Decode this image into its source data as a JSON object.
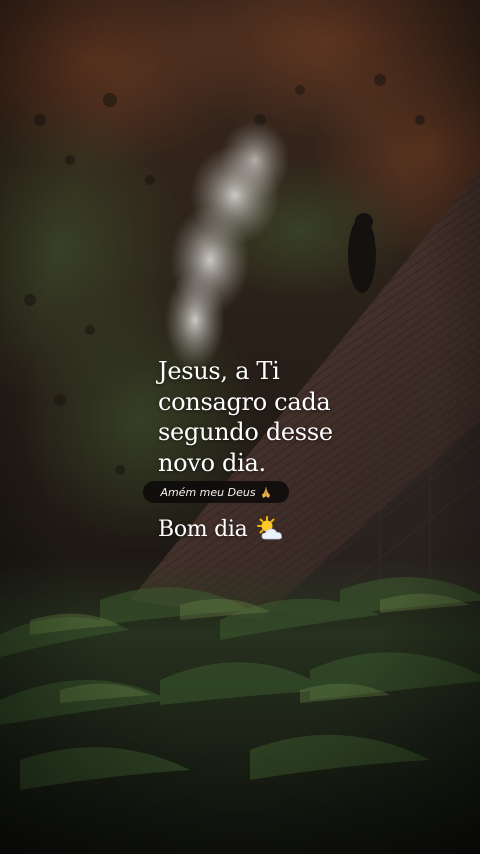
{
  "quote": {
    "lines": [
      "Jesus, a Ti",
      "consagro cada",
      "segundo desse",
      "novo dia."
    ]
  },
  "caption_pill": {
    "text": "Amém meu Deus",
    "emoji_icon": "praying-hands-icon"
  },
  "greeting": {
    "text": "Bom dia",
    "emoji_icon": "sun-behind-cloud-icon"
  },
  "colors": {
    "text": "#ffffff",
    "pill_background": "#0a080a"
  }
}
